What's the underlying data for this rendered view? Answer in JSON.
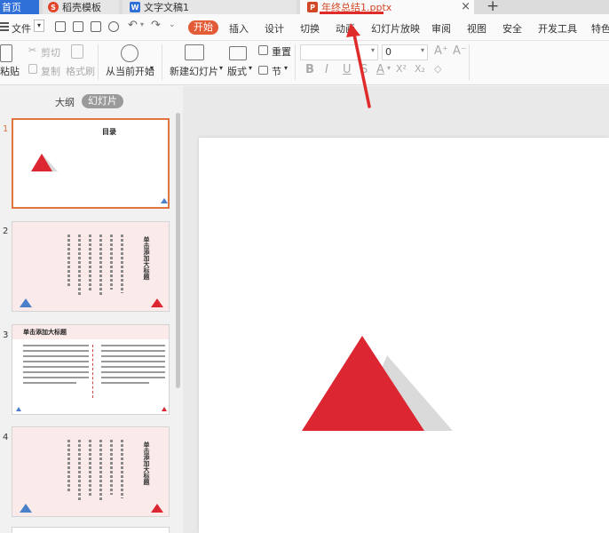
{
  "tabs": {
    "home": "首页",
    "docer": "稻壳模板",
    "doc": "文字文稿1",
    "ppt": "年终总结1.pptx",
    "close": "×",
    "new": "+"
  },
  "menu": {
    "file": "文件",
    "items": [
      "开始",
      "插入",
      "设计",
      "切换",
      "动画",
      "幻灯片放映",
      "审阅",
      "视图",
      "安全",
      "开发工具",
      "特色"
    ]
  },
  "ribbon": {
    "paste": "粘贴",
    "cut": "剪切",
    "copy": "复制",
    "format_painter": "格式刷",
    "play_from_current": "从当前开始",
    "new_slide": "新建幻灯片",
    "layout": "版式",
    "reset": "重置",
    "section": "节",
    "font_size": "0",
    "bold": "B",
    "italic": "I",
    "underline": "U",
    "strike": "S",
    "font_color": "A",
    "superscript": "X²",
    "subscript": "X₂",
    "clear": "◇",
    "grow": "A⁺",
    "shrink": "A⁻"
  },
  "panel": {
    "outline_tab": "大纲",
    "slides_tab": "幻灯片",
    "slides": [
      {
        "num": "1",
        "title": "目录"
      },
      {
        "num": "2",
        "title": "单击添加大标题"
      },
      {
        "num": "3",
        "title": "单击添加大标题"
      },
      {
        "num": "4",
        "title": "单击添加大标题"
      }
    ]
  },
  "colors": {
    "accent": "#e25b36",
    "ppt_tab": "#d24726",
    "triangle_red": "#dc2632",
    "triangle_gray": "#dadada",
    "triangle_blue": "#4a7fc9",
    "arrow": "#e02b2b"
  }
}
